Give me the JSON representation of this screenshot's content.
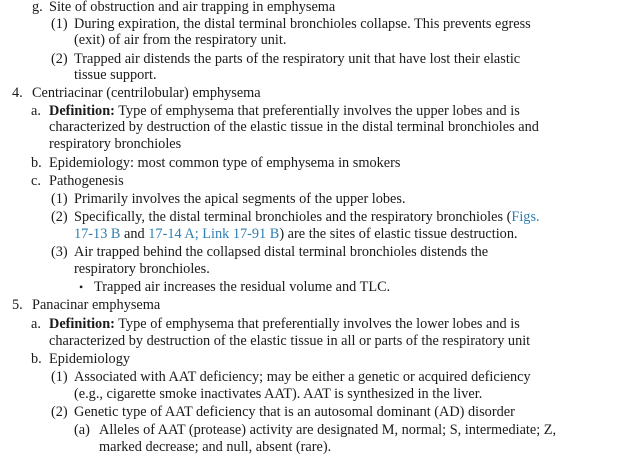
{
  "lines": [
    {
      "m": "g.",
      "t": "Site of obstruction and air trapping in emphysema"
    },
    {
      "m": "(1)",
      "t": "During expiration, the distal terminal bronchioles collapse. This prevents egress"
    },
    {
      "t": "(exit) of air from the respiratory unit."
    },
    {
      "m": "(2)",
      "t": "Trapped air distends the parts of the respiratory unit that have lost their elastic"
    },
    {
      "t": "tissue support."
    },
    {
      "m": "4.",
      "t": "Centriacinar (centrilobular) emphysema"
    },
    {
      "m": "a.",
      "b": "Definition:",
      "t": " Type of emphysema that preferentially involves the upper lobes and is"
    },
    {
      "t": "characterized by destruction of the elastic tissue in the distal terminal bronchioles and"
    },
    {
      "t": "respiratory bronchioles"
    },
    {
      "m": "b.",
      "t": "Epidemiology: most common type of emphysema in smokers"
    },
    {
      "m": "c.",
      "t": "Pathogenesis"
    },
    {
      "m": "(1)",
      "t": "Primarily involves the apical segments of the upper lobes."
    },
    {
      "m": "(2)",
      "t": "Specifically, the distal terminal bronchioles and the respiratory bronchioles (",
      "l": "Figs."
    },
    {
      "l": "17-13 B",
      "t": " and ",
      "l2": "17-14 A; Link 17-91 B",
      "t2": ") are the sites of elastic tissue destruction."
    },
    {
      "m": "(3)",
      "t": "Air trapped behind the collapsed distal terminal bronchioles distends the"
    },
    {
      "t": "respiratory bronchioles."
    },
    {
      "m": "•",
      "t": "Trapped air increases the residual volume and TLC."
    },
    {
      "m": "5.",
      "t": "Panacinar emphysema"
    },
    {
      "m": "a.",
      "b": "Definition:",
      "t": " Type of emphysema that preferentially involves the lower lobes and is"
    },
    {
      "t": "characterized by destruction of the elastic tissue in all or parts of the respiratory unit"
    },
    {
      "m": "b.",
      "t": "Epidemiology"
    },
    {
      "m": "(1)",
      "t": "Associated with AAT deficiency; may be either a genetic or acquired deficiency"
    },
    {
      "t": "(e.g., cigarette smoke inactivates AAT). AAT is synthesized in the liver."
    },
    {
      "m": "(2)",
      "t": "Genetic type of AAT deficiency that is an autosomal dominant (AD) disorder"
    },
    {
      "m": "(a)",
      "t": "Alleles of AAT (protease) activity are designated M, normal; S, intermediate; Z,"
    },
    {
      "t": "marked decrease; and null, absent (rare)."
    }
  ]
}
